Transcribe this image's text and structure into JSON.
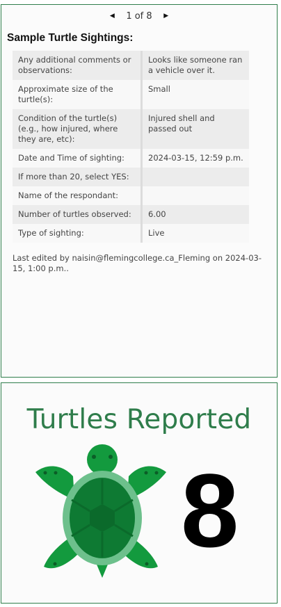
{
  "popup": {
    "pager": {
      "prev_icon": "caret-left-icon",
      "text": "1 of 8",
      "next_icon": "caret-right-icon"
    },
    "title": "Sample Turtle Sightings:",
    "attributes": [
      {
        "field": "Any additional comments or observations:",
        "value": "Looks like someone ran a vehicle over it."
      },
      {
        "field": "Approximate size of the turtle(s):",
        "value": "Small"
      },
      {
        "field": "Condition of the turtle(s) (e.g., how injured, where they are, etc):",
        "value": "Injured shell and passed out"
      },
      {
        "field": "Date and Time of sighting:",
        "value": "2024-03-15, 12:59 p.m."
      },
      {
        "field": "If more than 20, select YES:",
        "value": ""
      },
      {
        "field": "Name of the respondant:",
        "value": ""
      },
      {
        "field": "Number of turtles observed:",
        "value": "6.00"
      },
      {
        "field": "Type of sighting:",
        "value": "Live"
      }
    ],
    "last_edited": "Last edited by naisin@flemingcollege.ca_Fleming on 2024-03-15, 1:00 p.m.."
  },
  "indicator": {
    "title": "Turtles Reported",
    "icon": "turtle-icon",
    "value": "8"
  },
  "colors": {
    "accent_green": "#2f7d4b",
    "turtle_dark": "#0e7a33",
    "turtle_mid": "#139a3e",
    "turtle_light": "#6dc08c"
  }
}
